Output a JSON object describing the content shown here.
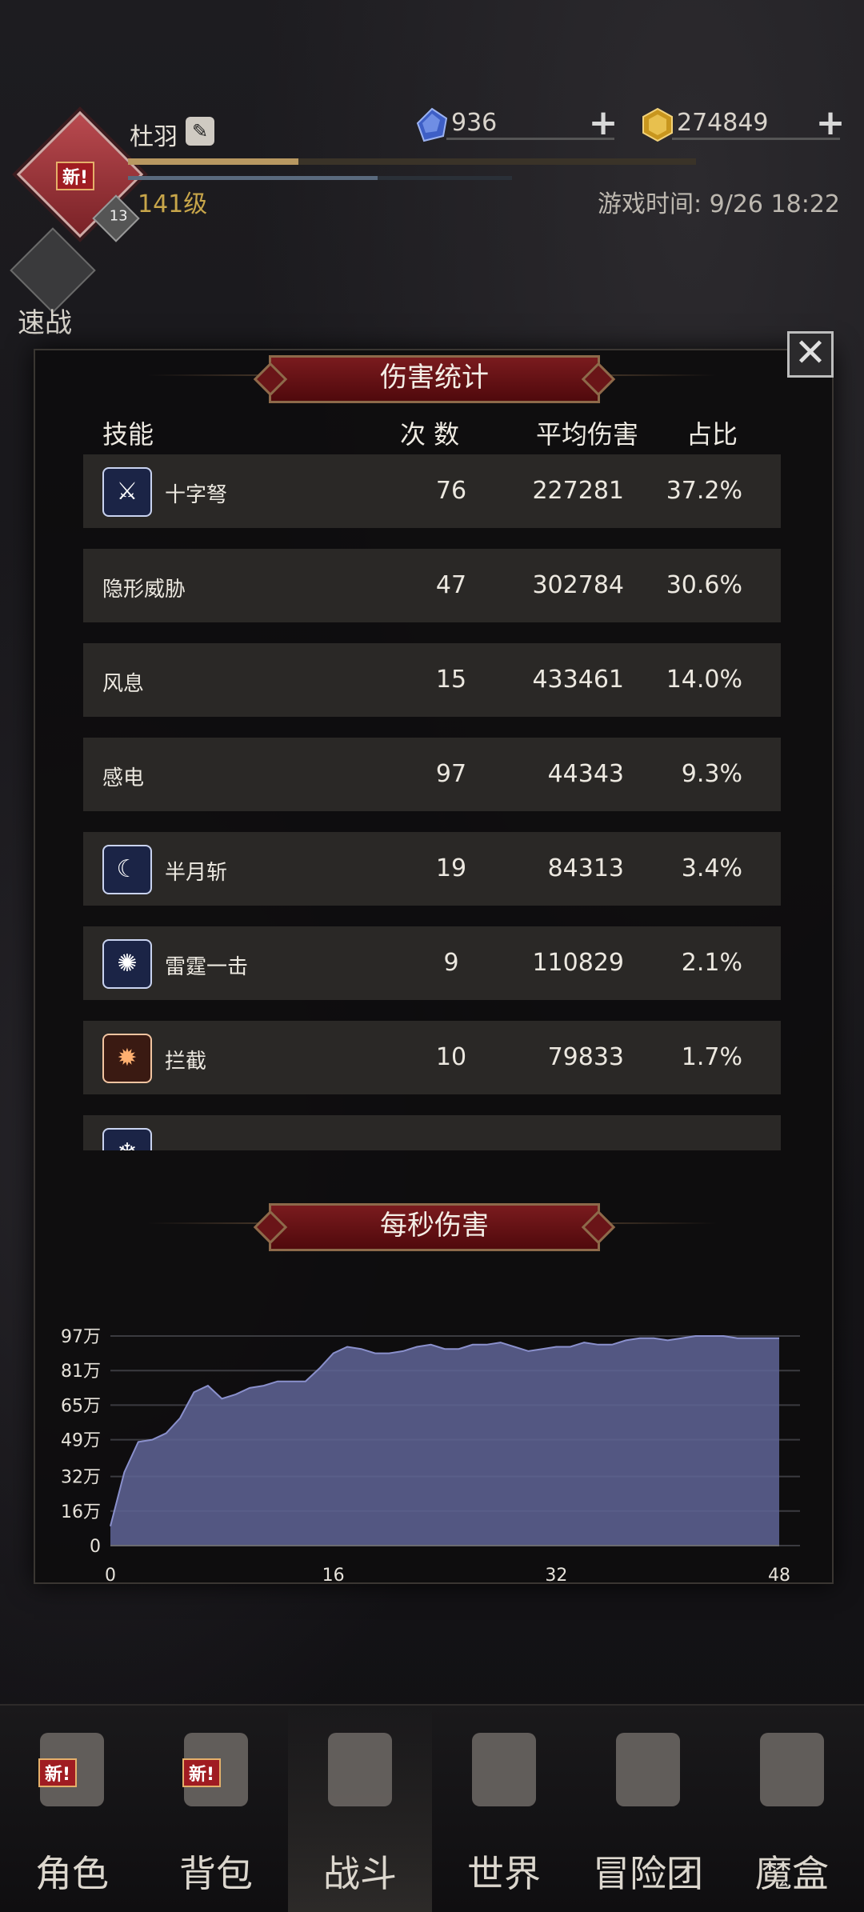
{
  "player": {
    "name": "杜羽",
    "level": "141级",
    "badge_level": "13",
    "new_tag": "新!",
    "xp_fraction": 0.3,
    "mp_fraction": 0.65
  },
  "currencies": [
    {
      "name": "blue-gem",
      "amount": "936",
      "color": "#4a6fd6"
    },
    {
      "name": "gold-gem",
      "amount": "274849",
      "color": "#d6a62a"
    }
  ],
  "game_time": "游戏时间: 9/26 18:22",
  "quick_battle": {
    "label": "速战"
  },
  "damage_stats": {
    "title": "伤害统计",
    "headers": {
      "skill": "技能",
      "count": "次 数",
      "avg": "平均伤害",
      "ratio": "占比"
    },
    "rows": [
      {
        "icon": "crossbow-icon",
        "name": "十字弩",
        "count": "76",
        "avg": "227281",
        "ratio": "37.2%"
      },
      {
        "icon": "",
        "name": "隐形威胁",
        "count": "47",
        "avg": "302784",
        "ratio": "30.6%"
      },
      {
        "icon": "",
        "name": "风息",
        "count": "15",
        "avg": "433461",
        "ratio": "14.0%"
      },
      {
        "icon": "",
        "name": "感电",
        "count": "97",
        "avg": "44343",
        "ratio": "9.3%"
      },
      {
        "icon": "crescent-moon-icon",
        "name": "半月斩",
        "count": "19",
        "avg": "84313",
        "ratio": "3.4%"
      },
      {
        "icon": "thunder-orb-icon",
        "name": "雷霆一击",
        "count": "9",
        "avg": "110829",
        "ratio": "2.1%"
      },
      {
        "icon": "fire-swirl-icon",
        "name": "拦截",
        "count": "10",
        "avg": "79833",
        "ratio": "1.7%"
      },
      {
        "icon": "ice-icon",
        "name": "",
        "count": "",
        "avg": "",
        "ratio": ""
      }
    ]
  },
  "dps": {
    "title": "每秒伤害"
  },
  "chart_data": {
    "type": "area",
    "title": "每秒伤害",
    "xlabel": "",
    "ylabel": "",
    "x_ticks": [
      0,
      16,
      32,
      48
    ],
    "y_ticks": [
      0,
      16,
      32,
      49,
      65,
      81,
      97
    ],
    "y_tick_labels": [
      "0",
      "16万",
      "32万",
      "49万",
      "65万",
      "81万",
      "97万"
    ],
    "xlim": [
      0,
      48
    ],
    "ylim": [
      0,
      97
    ],
    "color": "#5f6596",
    "x": [
      0,
      1,
      2,
      3,
      4,
      5,
      6,
      7,
      8,
      9,
      10,
      11,
      12,
      13,
      14,
      15,
      16,
      17,
      18,
      19,
      20,
      21,
      22,
      23,
      24,
      25,
      26,
      27,
      28,
      29,
      30,
      31,
      32,
      33,
      34,
      35,
      36,
      37,
      38,
      39,
      40,
      41,
      42,
      43,
      44,
      45,
      46,
      47,
      48
    ],
    "values": [
      9,
      34,
      48,
      49,
      52,
      59,
      71,
      74,
      68,
      70,
      73,
      74,
      76,
      76,
      76,
      82,
      89,
      92,
      91,
      89,
      89,
      90,
      92,
      93,
      91,
      91,
      93,
      93,
      94,
      92,
      90,
      91,
      92,
      92,
      94,
      93,
      93,
      95,
      96,
      96,
      95,
      96,
      97,
      97,
      97,
      96,
      96,
      96,
      96
    ]
  },
  "nav": [
    {
      "label": "角色",
      "icon": "helmet-icon",
      "new": "新!"
    },
    {
      "label": "背包",
      "icon": "backpack-icon",
      "new": "新!"
    },
    {
      "label": "战斗",
      "icon": "sword-shield-icon",
      "new": ""
    },
    {
      "label": "世界",
      "icon": "map-scroll-icon",
      "new": ""
    },
    {
      "label": "冒险团",
      "icon": "castle-icon",
      "new": ""
    },
    {
      "label": "魔盒",
      "icon": "magic-cube-icon",
      "new": ""
    }
  ]
}
